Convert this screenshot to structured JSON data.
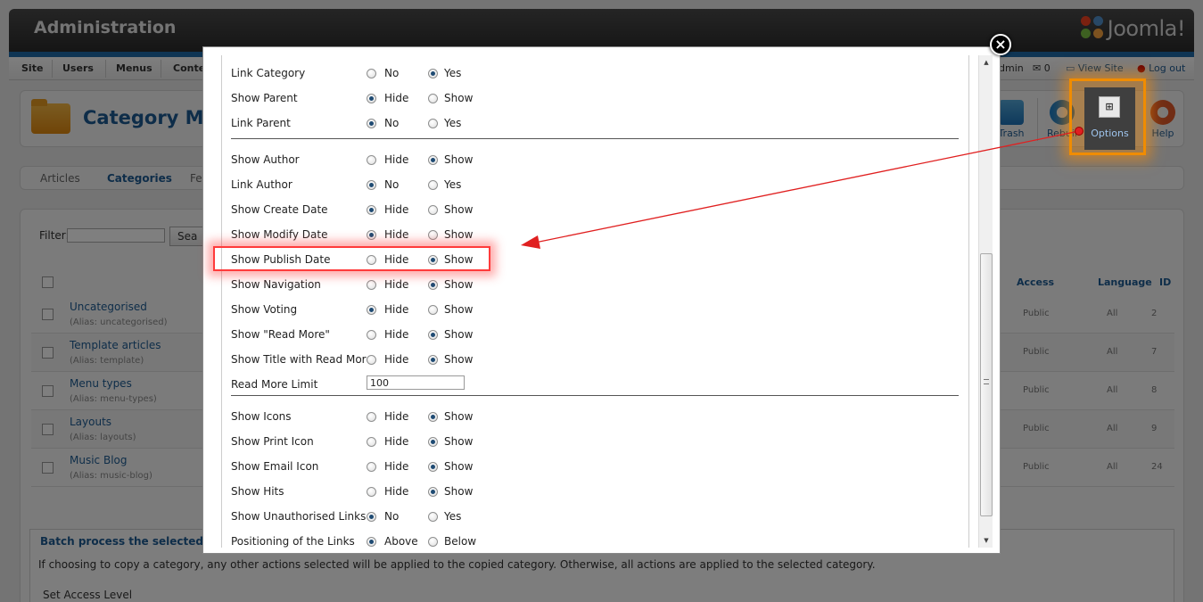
{
  "header": {
    "title": "Administration",
    "logo_text": "Joomla!"
  },
  "menubar": {
    "items": [
      "Site",
      "Users",
      "Menus",
      "Conte"
    ],
    "user": "dmin",
    "messages": "0",
    "view_site": "View Site",
    "logout": "Log out"
  },
  "toolbar": {
    "title": "Category Ma",
    "buttons": {
      "trash": "Trash",
      "rebuild": "Rebuil",
      "options": "Options",
      "help": "Help"
    }
  },
  "subnav": {
    "tabs": [
      "Articles",
      "Categories",
      "Fe"
    ],
    "active": "Categories"
  },
  "list": {
    "filter_label": "Filter:",
    "filter_value": "",
    "search_button": "Sea",
    "columns": {
      "access": "Access",
      "language": "Language",
      "id": "ID"
    },
    "rows": [
      {
        "name": "Uncategorised",
        "alias": "(Alias: uncategorised)",
        "access": "Public",
        "language": "All",
        "id": "2"
      },
      {
        "name": "Template articles",
        "alias": "(Alias: template)",
        "access": "Public",
        "language": "All",
        "id": "7"
      },
      {
        "name": "Menu types",
        "alias": "(Alias: menu-types)",
        "access": "Public",
        "language": "All",
        "id": "8"
      },
      {
        "name": "Layouts",
        "alias": "(Alias: layouts)",
        "access": "Public",
        "language": "All",
        "id": "9"
      },
      {
        "name": "Music Blog",
        "alias": "(Alias: music-blog)",
        "access": "Public",
        "language": "All",
        "id": "24"
      }
    ]
  },
  "batch": {
    "legend": "Batch process the selected c",
    "description": "If choosing to copy a category, any other actions selected will be applied to the copied category. Otherwise, all actions are applied to the selected category.",
    "set_access_level": "Set Access Level"
  },
  "modal": {
    "close_symbol": "×",
    "read_more_limit_label": "Read More Limit",
    "read_more_limit_value": "100",
    "fields": [
      {
        "label": "Link Category",
        "opt1": "No",
        "opt2": "Yes",
        "selected": 2
      },
      {
        "label": "Show Parent",
        "opt1": "Hide",
        "opt2": "Show",
        "selected": 1
      },
      {
        "label": "Link Parent",
        "opt1": "No",
        "opt2": "Yes",
        "selected": 1
      },
      {
        "label": "Show Author",
        "opt1": "Hide",
        "opt2": "Show",
        "selected": 2
      },
      {
        "label": "Link Author",
        "opt1": "No",
        "opt2": "Yes",
        "selected": 1
      },
      {
        "label": "Show Create Date",
        "opt1": "Hide",
        "opt2": "Show",
        "selected": 1
      },
      {
        "label": "Show Modify Date",
        "opt1": "Hide",
        "opt2": "Show",
        "selected": 1
      },
      {
        "label": "Show Publish Date",
        "opt1": "Hide",
        "opt2": "Show",
        "selected": 2
      },
      {
        "label": "Show Navigation",
        "opt1": "Hide",
        "opt2": "Show",
        "selected": 2
      },
      {
        "label": "Show Voting",
        "opt1": "Hide",
        "opt2": "Show",
        "selected": 1
      },
      {
        "label": "Show \"Read More\"",
        "opt1": "Hide",
        "opt2": "Show",
        "selected": 2
      },
      {
        "label": "Show Title with Read More",
        "opt1": "Hide",
        "opt2": "Show",
        "selected": 2
      },
      {
        "label": "Show Icons",
        "opt1": "Hide",
        "opt2": "Show",
        "selected": 2
      },
      {
        "label": "Show Print Icon",
        "opt1": "Hide",
        "opt2": "Show",
        "selected": 2
      },
      {
        "label": "Show Email Icon",
        "opt1": "Hide",
        "opt2": "Show",
        "selected": 2
      },
      {
        "label": "Show Hits",
        "opt1": "Hide",
        "opt2": "Show",
        "selected": 2
      },
      {
        "label": "Show Unauthorised Links",
        "opt1": "No",
        "opt2": "Yes",
        "selected": 1
      },
      {
        "label": "Positioning of the Links",
        "opt1": "Above",
        "opt2": "Below",
        "selected": 1
      }
    ]
  },
  "colors": {
    "accent": "#1d5b93",
    "highlight": "#ff3b3b",
    "options_glow": "#f08c00"
  }
}
